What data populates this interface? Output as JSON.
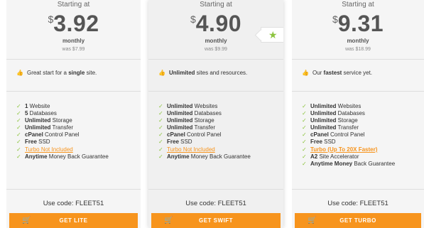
{
  "plans": [
    {
      "starting": "Starting at",
      "currency": "$",
      "price": "3.92",
      "period": "monthly",
      "was": "was $7.99",
      "tagline_pre": "Great start for a ",
      "tagline_bold": "single",
      "tagline_post": " site.",
      "features": [
        {
          "b": "1",
          "t": " Website"
        },
        {
          "b": "5",
          "t": " Databases"
        },
        {
          "b": "Unlimited",
          "t": " Storage"
        },
        {
          "b": "Unlimited",
          "t": " Transfer"
        },
        {
          "b": "cPanel",
          "t": " Control Panel"
        },
        {
          "b": "Free",
          "t": " SSD"
        },
        {
          "o": "Turbo Not Included"
        },
        {
          "b": "Anytime",
          "t": " Money Back Guarantee"
        }
      ],
      "code": "Use code: FLEET51",
      "button": "GET LITE"
    },
    {
      "starting": "Starting at",
      "currency": "$",
      "price": "4.90",
      "period": "monthly",
      "was": "was $9.99",
      "tagline_bold": "Unlimited",
      "tagline_post": " sites and resources.",
      "features": [
        {
          "b": "Unlimited",
          "t": " Websites"
        },
        {
          "b": "Unlimited",
          "t": " Databases"
        },
        {
          "b": "Unlimited",
          "t": " Storage"
        },
        {
          "b": "Unlimited",
          "t": " Transfer"
        },
        {
          "b": "cPanel",
          "t": " Control Panel"
        },
        {
          "b": "Free",
          "t": " SSD"
        },
        {
          "o": "Turbo Not Included"
        },
        {
          "b": "Anytime",
          "t": " Money Back Guarantee"
        }
      ],
      "code": "Use code: FLEET51",
      "button": "GET SWIFT"
    },
    {
      "starting": "Starting at",
      "currency": "$",
      "price": "9.31",
      "period": "monthly",
      "was": "was $18.99",
      "tagline_pre": "Our ",
      "tagline_bold": "fastest",
      "tagline_post": " service yet.",
      "features": [
        {
          "b": "Unlimited",
          "t": " Websites"
        },
        {
          "b": "Unlimited",
          "t": " Databases"
        },
        {
          "b": "Unlimited",
          "t": " Storage"
        },
        {
          "b": "Unlimited",
          "t": " Transfer"
        },
        {
          "b": "cPanel",
          "t": " Control Panel"
        },
        {
          "b": "Free",
          "t": " SSD"
        },
        {
          "o": "Turbo (Up To 20X Faster)"
        },
        {
          "b": "A2",
          "t": " Site Accelerator"
        },
        {
          "b": "Anytime Money",
          "t": " Back Guarantee"
        }
      ],
      "code": "Use code: FLEET51",
      "button": "GET TURBO"
    }
  ],
  "icons": {
    "check": "check-icon",
    "thumb": "thumbs-up-icon",
    "cart": "cart-icon",
    "star": "star-icon"
  },
  "colors": {
    "accent": "#f7941d",
    "check": "#8cc43e"
  }
}
